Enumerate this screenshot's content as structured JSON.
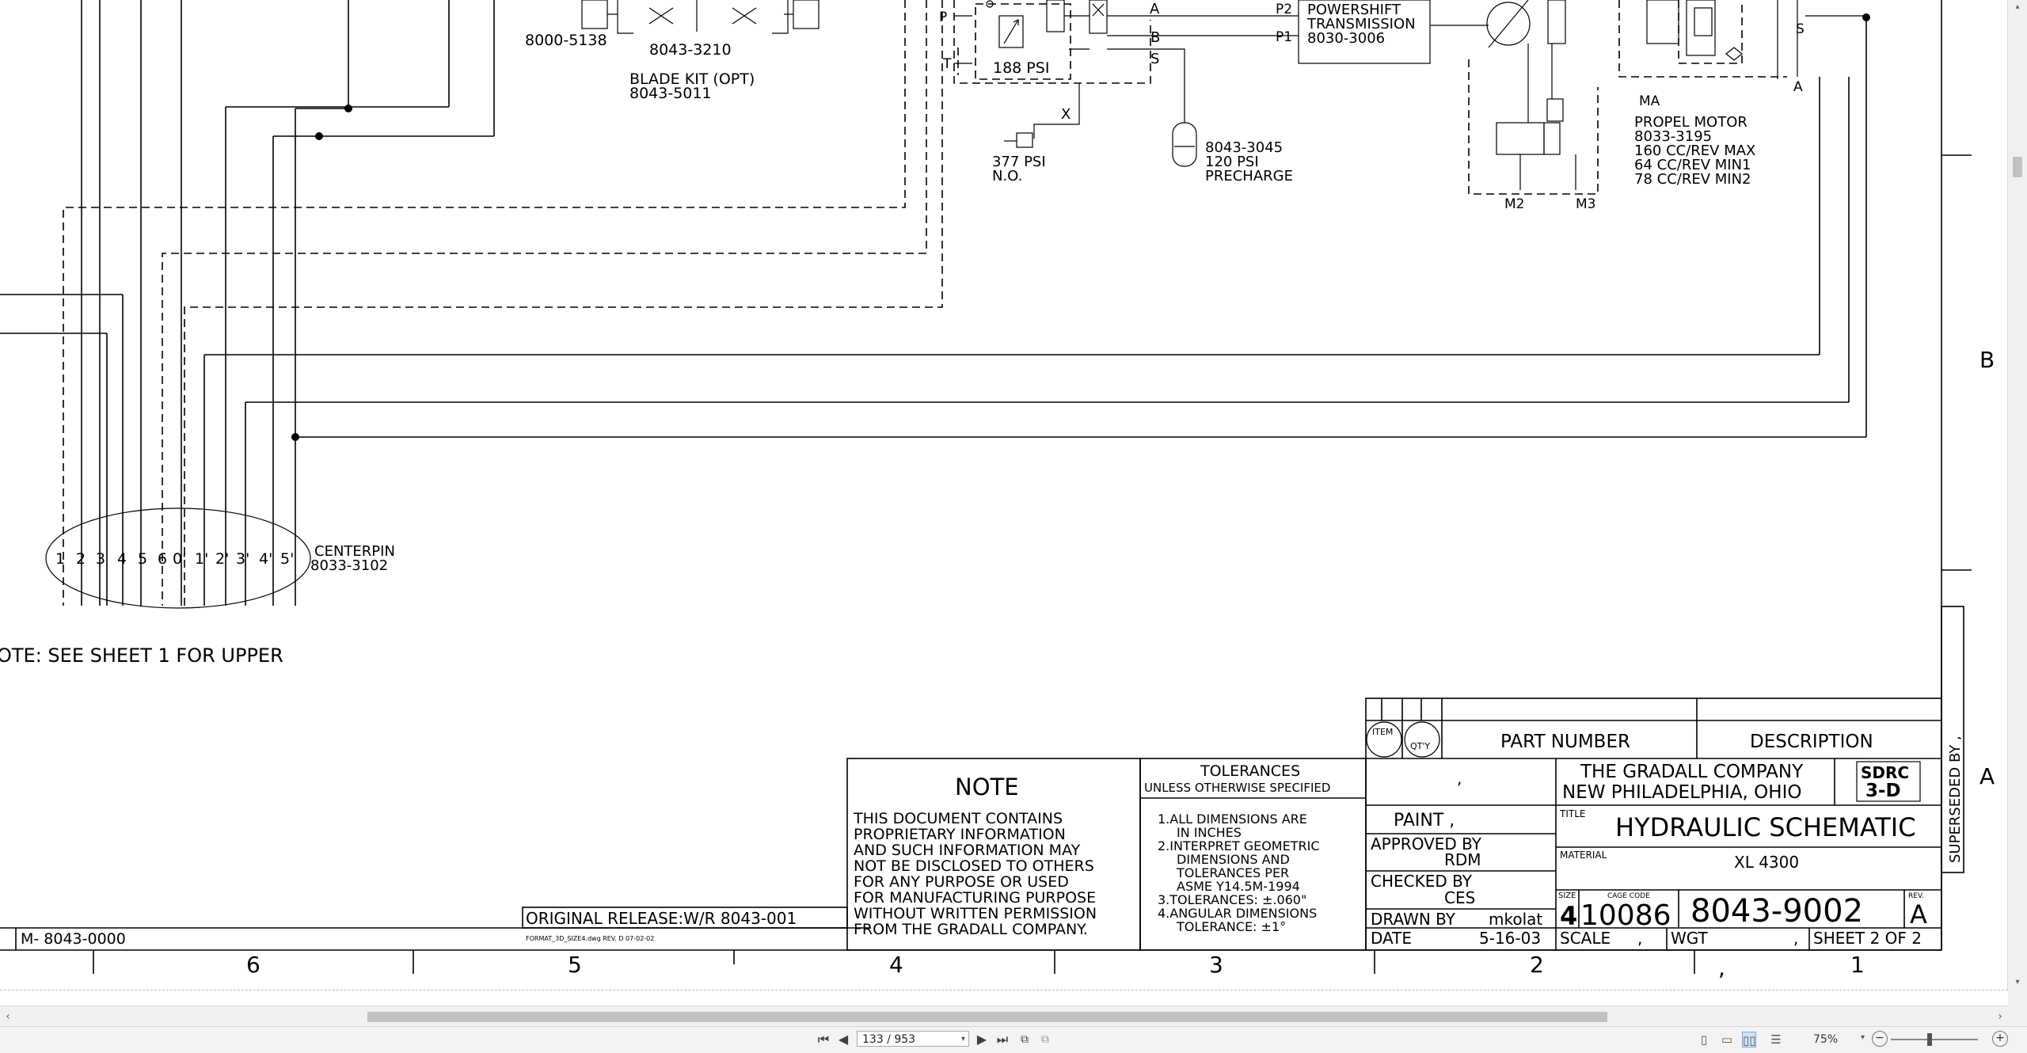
{
  "drawing": {
    "parts": {
      "valve_left": "8000-5138",
      "valve_blade": "8043-3210",
      "blade_kit": [
        "BLADE KIT (OPT)",
        "8043-5011"
      ],
      "relief": "188 PSI",
      "pilot": [
        "377 PSI",
        "N.O."
      ],
      "accumulator": [
        "8043-3045",
        "120 PSI",
        "PRECHARGE"
      ],
      "transmission": [
        "POWERSHIFT",
        "TRANSMISSION",
        "8030-3006"
      ],
      "ports": {
        "p": "P",
        "t": "T",
        "x": "X",
        "a": "A",
        "b": "B",
        "s": "S",
        "p1": "P1",
        "p2": "P2",
        "s2": "S",
        "a2": "A",
        "ma": "MA",
        "m2": "M2",
        "m3": "M3"
      },
      "propel_motor": [
        "PROPEL MOTOR",
        "8033-3195",
        "160 CC/REV MAX",
        "64 CC/REV MIN1",
        "78 CC/REV MIN2"
      ],
      "centerpin": [
        "CENTERPIN",
        "8033-3102"
      ],
      "centerpin_ports": [
        "1",
        "2",
        "3",
        "4",
        "5",
        "6",
        "0'",
        "1'",
        "2'",
        "3'",
        "4'",
        "5'"
      ]
    },
    "sheet_note": "OTE:  SEE SHEET 1 FOR UPPER",
    "zone_letters": {
      "b": "B",
      "a": "A"
    },
    "zone_numbers": [
      "6",
      "5",
      "4",
      "3",
      "2",
      "1"
    ],
    "ref_number": "M- 8043-0000",
    "original_release": "ORIGINAL RELEASE:W/R 8043-001",
    "format_text": "FORMAT_3D_SIZE4.dwg  REV. D 07-02-02",
    "note": {
      "title": "NOTE",
      "lines": [
        "THIS DOCUMENT CONTAINS",
        "PROPRIETARY INFORMATION",
        "AND SUCH INFORMATION MAY",
        "NOT BE DISCLOSED TO OTHERS",
        "FOR ANY PURPOSE OR USED",
        "FOR MANUFACTURING PURPOSE",
        "WITHOUT WRITTEN PERMISSION",
        "FROM THE GRADALL COMPANY."
      ]
    },
    "tolerances": {
      "title": "TOLERANCES",
      "subtitle": "UNLESS OTHERWISE SPECIFIED",
      "lines": [
        "1.ALL DIMENSIONS ARE",
        "IN INCHES",
        "2.INTERPRET GEOMETRIC",
        "DIMENSIONS AND",
        "TOLERANCES PER",
        "ASME Y14.5M-1994",
        "3.TOLERANCES: ±.060\"",
        "4.ANGULAR DIMENSIONS",
        "TOLERANCE: ±1°"
      ]
    },
    "title_block": {
      "item": "ITEM",
      "qty": "QT'Y",
      "part_number": "PART NUMBER",
      "description": "DESCRIPTION",
      "company": "THE GRADALL COMPANY",
      "location": "NEW PHILADELPHIA, OHIO",
      "logo": [
        "SDRC",
        "3-D"
      ],
      "paint": "PAINT ,",
      "approved_by_label": "APPROVED BY",
      "approved_by": "RDM",
      "checked_by_label": "CHECKED BY",
      "checked_by": "CES",
      "drawn_by_label": "DRAWN BY",
      "drawn_by": "mkolat",
      "date_label": "DATE",
      "date": "5-16-03",
      "title_label": "TITLE",
      "title": "HYDRAULIC SCHEMATIC",
      "material_label": "MATERIAL",
      "material": "XL 4300",
      "size_label": "SIZE",
      "size": "4",
      "cage_label": "CAGE CODE",
      "cage": "10086",
      "drawing_number": "8043-9002",
      "rev_label": "REV.",
      "rev": "A",
      "scale_label": "SCALE",
      "scale_val": ",",
      "wgt_label": "WGT",
      "sheet": "SHEET 2 OF 2",
      "superseded": "SUPERSEDED BY ,",
      "comma": ","
    }
  },
  "viewer": {
    "page_field": "133 / 953",
    "zoom": "75%"
  }
}
